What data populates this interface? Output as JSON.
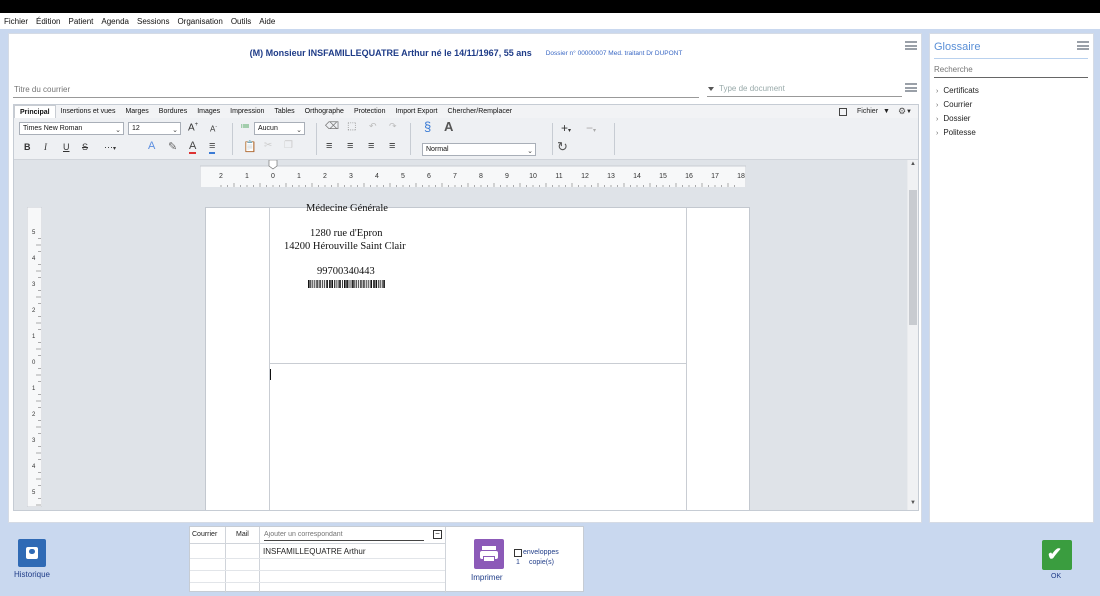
{
  "menu": [
    "Fichier",
    "Édition",
    "Patient",
    "Agenda",
    "Sessions",
    "Organisation",
    "Outils",
    "Aide"
  ],
  "patient": {
    "name": "(M) Monsieur INSFAMILLEQUATRE Arthur né le 14/11/1967, 55 ans",
    "info": "Dossier n° 00000007 Med. traitant Dr DUPONT"
  },
  "courrier": {
    "title_placeholder": "Titre du courrier",
    "type_placeholder": "Type de document"
  },
  "tabs": [
    "Principal",
    "Insertions et vues",
    "Marges",
    "Bordures",
    "Images",
    "Impression",
    "Tables",
    "Orthographe",
    "Protection",
    "Import Export",
    "Chercher/Remplacer"
  ],
  "tab_right": {
    "fichier": "Fichier"
  },
  "toolbar": {
    "font": "Times New Roman",
    "size": "12",
    "list_style": "Aucun",
    "paragraph_style": "Normal"
  },
  "ruler": {
    "labels": [
      "2",
      "1",
      "0",
      "1",
      "2",
      "3",
      "4",
      "5",
      "6",
      "7",
      "8",
      "9",
      "10",
      "11",
      "12",
      "13",
      "14",
      "15",
      "16",
      "17",
      "18"
    ],
    "vlabels": [
      "5",
      "4",
      "3",
      "2",
      "1",
      "0",
      "1",
      "2",
      "3",
      "4",
      "5"
    ]
  },
  "document": {
    "line1": "Médecine Générale",
    "line2": "1280 rue d'Epron",
    "line3": "14200 Hérouville Saint Clair",
    "line4": "99700340443"
  },
  "glossaire": {
    "title": "Glossaire",
    "search_placeholder": "Recherche",
    "items": [
      "Certificats",
      "Courrier",
      "Dossier",
      "Politesse"
    ]
  },
  "bottom": {
    "historique": "Historique",
    "col_courrier": "Courrier",
    "col_mail": "Mail",
    "add_placeholder": "Ajouter un correspondant",
    "correspondant": "INSFAMILLEQUATRE Arthur",
    "imprimer": "Imprimer",
    "enveloppes": "enveloppes",
    "copies_count": "1",
    "copies_label": "copie(s)",
    "ok": "OK"
  }
}
